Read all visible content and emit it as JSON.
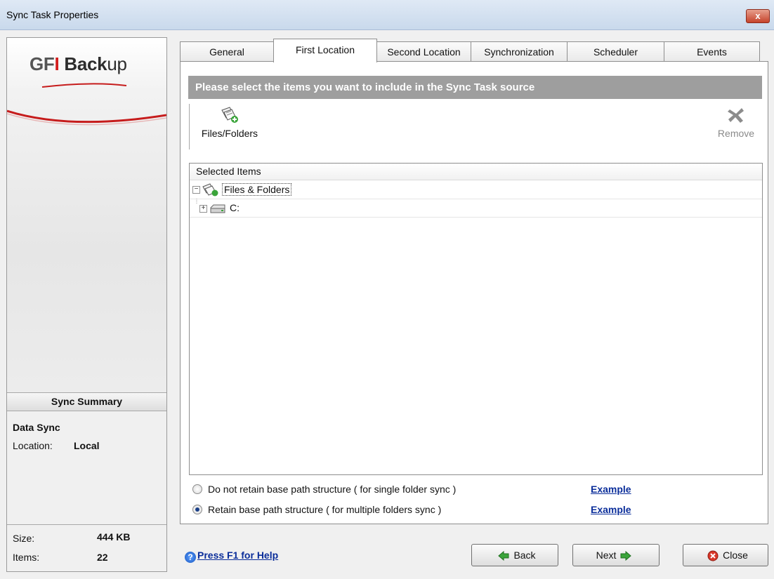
{
  "window": {
    "title": "Sync Task Properties",
    "close_glyph": "x"
  },
  "logo": {
    "gf": "GF",
    "i": "I",
    "back": "Back",
    "up": "up"
  },
  "summary": {
    "header": "Sync Summary",
    "type": "Data Sync",
    "location_label": "Location:",
    "location_value": "Local",
    "size_label": "Size:",
    "size_value": "444 KB",
    "items_label": "Items:",
    "items_value": "22"
  },
  "tabs": [
    {
      "label": "General"
    },
    {
      "label": "First Location",
      "active": true
    },
    {
      "label": "Second Location"
    },
    {
      "label": "Synchronization"
    },
    {
      "label": "Scheduler"
    },
    {
      "label": "Events"
    }
  ],
  "banner": "Please select the items you want to include in the Sync Task source",
  "toolbar": {
    "files_label": "Files/Folders",
    "files_icon": "add-files-folders-icon",
    "remove_label": "Remove",
    "remove_icon": "remove-x-icon"
  },
  "tree": {
    "header": "Selected Items",
    "rows": [
      {
        "label": "Files & Folders",
        "icon": "files-folders-icon",
        "expander": "−"
      },
      {
        "label": "C:",
        "icon": "drive-icon",
        "expander": "+"
      }
    ]
  },
  "options": {
    "no_retain_label": "Do not retain base path structure ( for single folder sync )",
    "retain_label": "Retain base path structure ( for multiple folders sync )",
    "selected": "retain",
    "example_label": "Example"
  },
  "footer": {
    "help_label": "Press F1 for Help",
    "help_glyph": "?",
    "back_label": "Back",
    "next_label": "Next",
    "close_label": "Close"
  },
  "colors": {
    "accent_link": "#0a2d9a",
    "banner_bg": "#9e9e9e",
    "brand_red": "#d41d1d"
  }
}
